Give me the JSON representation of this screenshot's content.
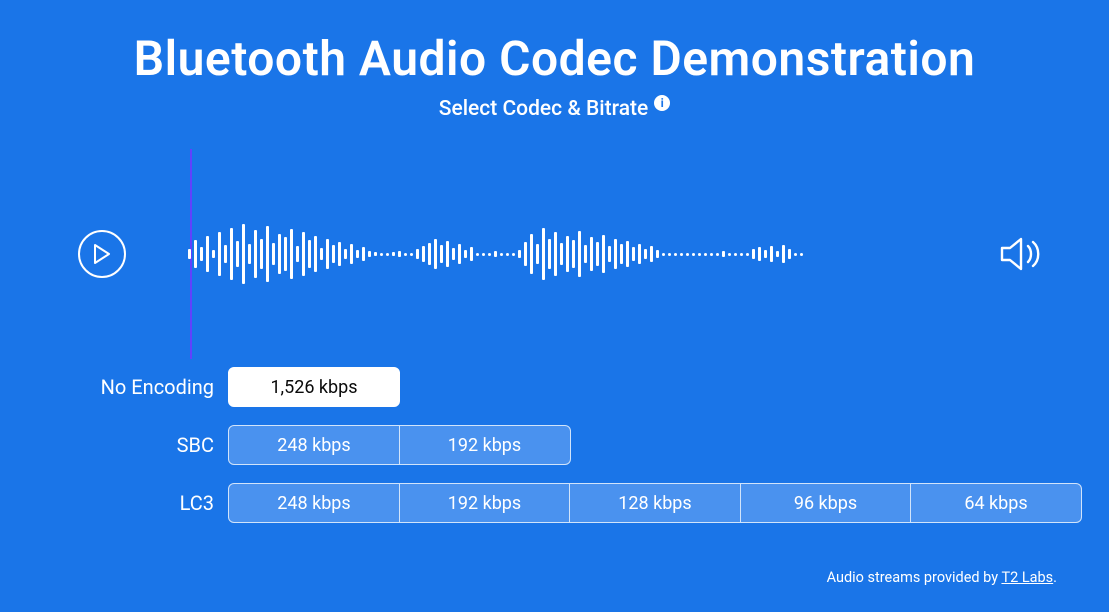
{
  "header": {
    "title": "Bluetooth Audio Codec Demonstration",
    "subtitle": "Select Codec & Bitrate",
    "info_glyph": "i"
  },
  "codecs": [
    {
      "label": "No Encoding",
      "options": [
        "1,526 kbps"
      ],
      "active_index": 0
    },
    {
      "label": "SBC",
      "options": [
        "248 kbps",
        "192 kbps"
      ],
      "active_index": -1
    },
    {
      "label": "LC3",
      "options": [
        "248 kbps",
        "192 kbps",
        "128 kbps",
        "96 kbps",
        "64 kbps"
      ],
      "active_index": -1
    }
  ],
  "attribution": {
    "prefix": "Audio streams provided by ",
    "link_text": "T2 Labs",
    "suffix": "."
  },
  "waveform_heights": [
    10,
    28,
    14,
    36,
    8,
    44,
    18,
    52,
    26,
    60,
    20,
    48,
    30,
    56,
    22,
    40,
    34,
    50,
    16,
    44,
    28,
    36,
    12,
    30,
    18,
    24,
    10,
    20,
    8,
    14,
    6,
    4,
    3,
    3,
    4,
    6,
    3,
    3,
    10,
    16,
    22,
    30,
    18,
    26,
    12,
    20,
    8,
    14,
    3,
    3,
    3,
    6,
    3,
    3,
    3,
    8,
    24,
    40,
    20,
    52,
    30,
    44,
    22,
    36,
    28,
    46,
    18,
    34,
    24,
    38,
    16,
    30,
    20,
    26,
    14,
    20,
    10,
    16,
    8,
    3,
    3,
    3,
    3,
    3,
    3,
    3,
    3,
    3,
    3,
    6,
    3,
    3,
    3,
    3,
    10,
    14,
    8,
    16,
    6,
    18,
    10,
    3,
    3
  ]
}
